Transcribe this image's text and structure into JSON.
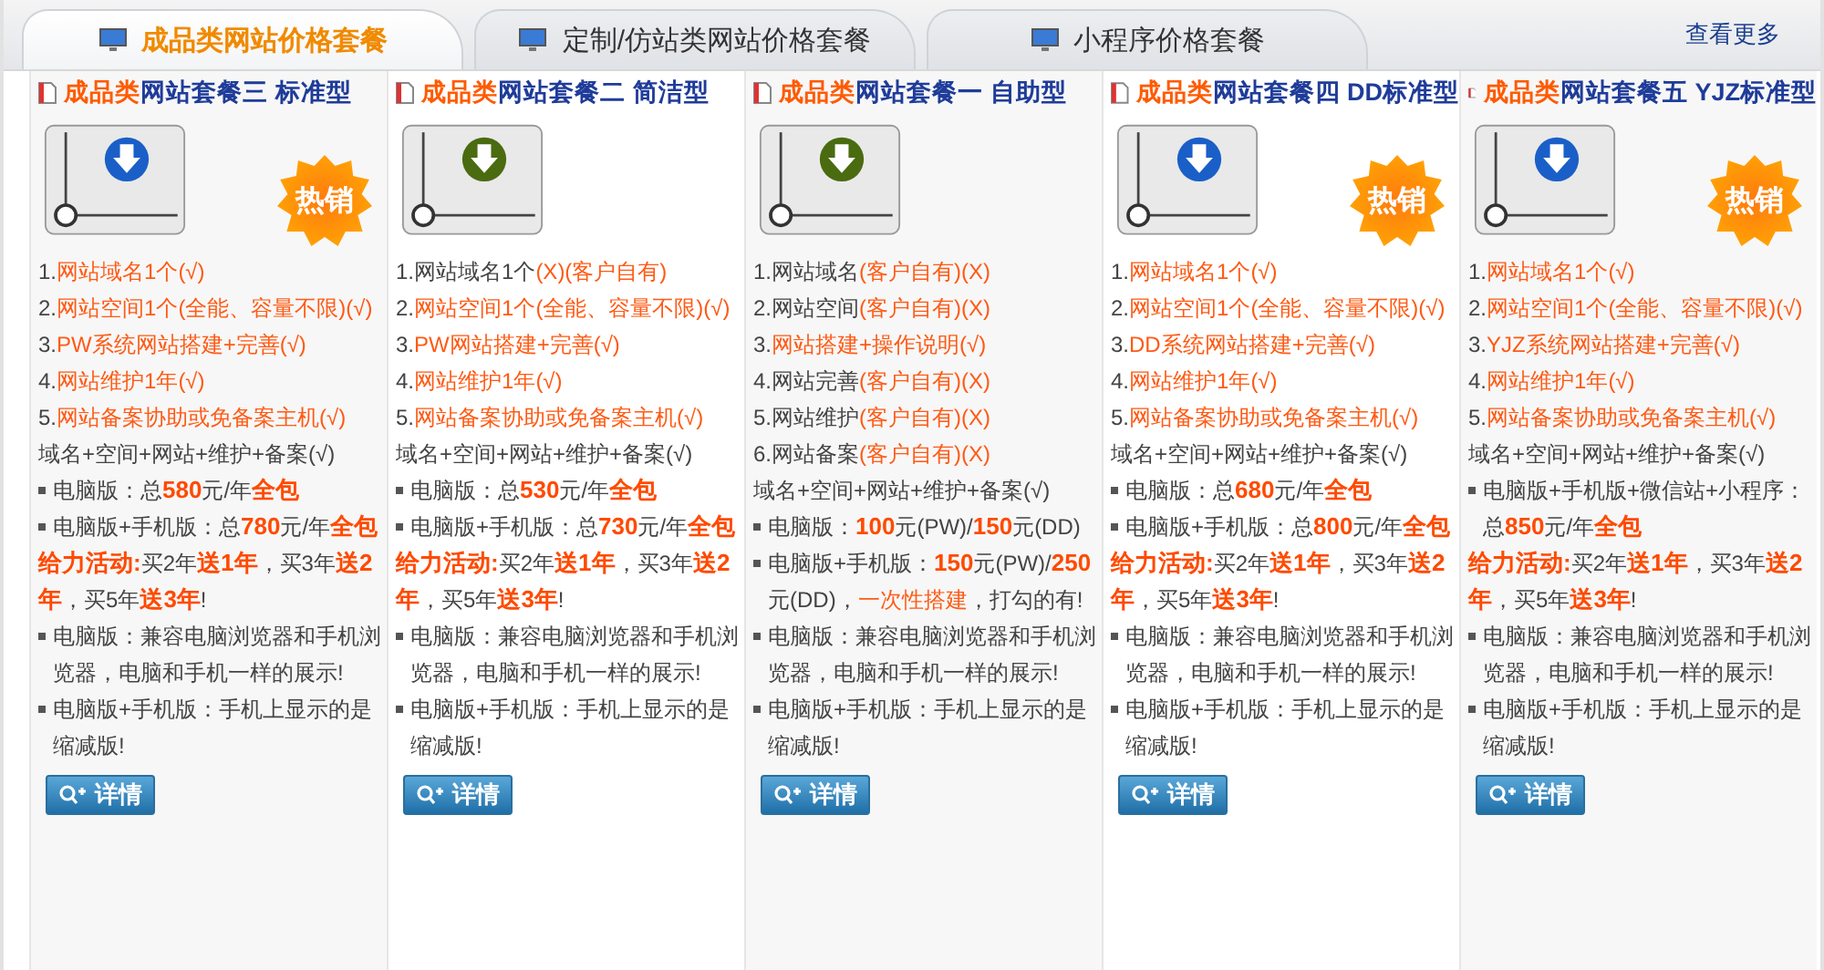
{
  "tabs": [
    {
      "label": "成品类网站价格套餐",
      "selected": true
    },
    {
      "label": "定制/仿站类网站价格套餐",
      "selected": false
    },
    {
      "label": "小程序价格套餐",
      "selected": false
    }
  ],
  "more_link": "查看更多",
  "cards": [
    {
      "title_prefix": "成品类",
      "title": "网站套餐三 标准型",
      "color": "#1a5fc8",
      "badge": "热销",
      "lines": [
        {
          "parts": [
            {
              "t": "1."
            },
            {
              "t": "网站域名1个(√)",
              "kind": "accent"
            }
          ]
        },
        {
          "parts": [
            {
              "t": "2."
            },
            {
              "t": "网站空间1个(全能、容量不限)(√)",
              "kind": "accent"
            }
          ]
        },
        {
          "parts": [
            {
              "t": "3."
            },
            {
              "t": "PW系统网站搭建+完善(√)",
              "kind": "accent"
            }
          ]
        },
        {
          "parts": [
            {
              "t": "4."
            },
            {
              "t": "网站维护1年(√)",
              "kind": "accent"
            }
          ]
        },
        {
          "parts": [
            {
              "t": "5."
            },
            {
              "t": "网站备案协助或免备案主机(√)",
              "kind": "accent"
            }
          ]
        },
        {
          "parts": [
            {
              "t": "域名+空间+网站+维护+备案(√)"
            }
          ]
        },
        {
          "bullet": true,
          "parts": [
            {
              "t": "电脑版：总"
            },
            {
              "t": "580",
              "kind": "strong"
            },
            {
              "t": "元/年"
            },
            {
              "t": "全包",
              "kind": "strong"
            }
          ]
        },
        {
          "bullet": true,
          "parts": [
            {
              "t": "电脑版+手机版：总"
            },
            {
              "t": "780",
              "kind": "strong"
            },
            {
              "t": "元/年"
            },
            {
              "t": "全包",
              "kind": "strong"
            }
          ]
        },
        {
          "parts": [
            {
              "t": "给力活动:",
              "kind": "strong"
            },
            {
              "t": "买2年"
            },
            {
              "t": "送1年",
              "kind": "strong"
            },
            {
              "t": "，买3年"
            },
            {
              "t": "送2年",
              "kind": "strong"
            },
            {
              "t": "，买5年"
            },
            {
              "t": "送3年",
              "kind": "strong"
            },
            {
              "t": "!"
            }
          ]
        },
        {
          "bullet": true,
          "parts": [
            {
              "t": "电脑版：兼容电脑浏览器和手机浏览器，电脑和手机一样的展示!"
            }
          ]
        },
        {
          "bullet": true,
          "parts": [
            {
              "t": "电脑版+手机版：手机上显示的是缩减版!"
            }
          ]
        }
      ],
      "button": "详情"
    },
    {
      "title_prefix": "成品类",
      "title": "网站套餐二 简洁型",
      "color": "#4a6b10",
      "lines": [
        {
          "parts": [
            {
              "t": "1.网站域名1个"
            },
            {
              "t": "(X)(客户自有)",
              "kind": "accent"
            }
          ]
        },
        {
          "parts": [
            {
              "t": "2."
            },
            {
              "t": "网站空间1个(全能、容量不限)(√)",
              "kind": "accent"
            }
          ]
        },
        {
          "parts": [
            {
              "t": "3."
            },
            {
              "t": "PW网站搭建+完善(√)",
              "kind": "accent"
            }
          ]
        },
        {
          "parts": [
            {
              "t": "4."
            },
            {
              "t": "网站维护1年(√)",
              "kind": "accent"
            }
          ]
        },
        {
          "parts": [
            {
              "t": "5."
            },
            {
              "t": "网站备案协助或免备案主机(√)",
              "kind": "accent"
            }
          ]
        },
        {
          "parts": [
            {
              "t": "域名+空间+网站+维护+备案(√)"
            }
          ]
        },
        {
          "bullet": true,
          "parts": [
            {
              "t": "电脑版：总"
            },
            {
              "t": "530",
              "kind": "strong"
            },
            {
              "t": "元/年"
            },
            {
              "t": "全包",
              "kind": "strong"
            }
          ]
        },
        {
          "bullet": true,
          "parts": [
            {
              "t": "电脑版+手机版：总"
            },
            {
              "t": "730",
              "kind": "strong"
            },
            {
              "t": "元/年"
            },
            {
              "t": "全包",
              "kind": "strong"
            }
          ]
        },
        {
          "parts": [
            {
              "t": "给力活动:",
              "kind": "strong"
            },
            {
              "t": "买2年"
            },
            {
              "t": "送1年",
              "kind": "strong"
            },
            {
              "t": "，买3年"
            },
            {
              "t": "送2年",
              "kind": "strong"
            },
            {
              "t": "，买5年"
            },
            {
              "t": "送3年",
              "kind": "strong"
            },
            {
              "t": "!"
            }
          ]
        },
        {
          "bullet": true,
          "parts": [
            {
              "t": "电脑版：兼容电脑浏览器和手机浏览器，电脑和手机一样的展示!"
            }
          ]
        },
        {
          "bullet": true,
          "parts": [
            {
              "t": "电脑版+手机版：手机上显示的是缩减版!"
            }
          ]
        }
      ],
      "button": "详情"
    },
    {
      "title_prefix": "成品类",
      "title": "网站套餐一 自助型",
      "color": "#4a6b10",
      "lines": [
        {
          "parts": [
            {
              "t": "1.网站域名"
            },
            {
              "t": "(客户自有)(X)",
              "kind": "accent"
            }
          ]
        },
        {
          "parts": [
            {
              "t": "2.网站空间"
            },
            {
              "t": "(客户自有)(X)",
              "kind": "accent"
            }
          ]
        },
        {
          "parts": [
            {
              "t": "3."
            },
            {
              "t": "网站搭建+操作说明(√)",
              "kind": "accent"
            }
          ]
        },
        {
          "parts": [
            {
              "t": "4.网站完善"
            },
            {
              "t": "(客户自有)(X)",
              "kind": "accent"
            }
          ]
        },
        {
          "parts": [
            {
              "t": "5.网站维护"
            },
            {
              "t": "(客户自有)(X)",
              "kind": "accent"
            }
          ]
        },
        {
          "parts": [
            {
              "t": "6.网站备案"
            },
            {
              "t": "(客户自有)(X)",
              "kind": "accent"
            }
          ]
        },
        {
          "parts": [
            {
              "t": "域名+空间+网站+维护+备案(√)"
            }
          ]
        },
        {
          "bullet": true,
          "parts": [
            {
              "t": "电脑版："
            },
            {
              "t": "100",
              "kind": "strong"
            },
            {
              "t": "元(PW)/"
            },
            {
              "t": "150",
              "kind": "strong"
            },
            {
              "t": "元(DD)"
            }
          ]
        },
        {
          "bullet": true,
          "parts": [
            {
              "t": "电脑版+手机版："
            },
            {
              "t": "150",
              "kind": "strong"
            },
            {
              "t": "元(PW)/"
            },
            {
              "t": "250",
              "kind": "strong"
            },
            {
              "t": "元(DD)，"
            },
            {
              "t": "一次性搭建",
              "kind": "accent"
            },
            {
              "t": "，打勾的有!"
            }
          ]
        },
        {
          "bullet": true,
          "parts": [
            {
              "t": "电脑版：兼容电脑浏览器和手机浏览器，电脑和手机一样的展示!"
            }
          ]
        },
        {
          "bullet": true,
          "parts": [
            {
              "t": "电脑版+手机版：手机上显示的是缩减版!"
            }
          ]
        }
      ],
      "button": "详情"
    },
    {
      "title_prefix": "成品类",
      "title": "网站套餐四 DD标准型",
      "color": "#1a5fc8",
      "badge": "热销",
      "lines": [
        {
          "parts": [
            {
              "t": "1."
            },
            {
              "t": "网站域名1个(√)",
              "kind": "accent"
            }
          ]
        },
        {
          "parts": [
            {
              "t": "2."
            },
            {
              "t": "网站空间1个(全能、容量不限)(√)",
              "kind": "accent"
            }
          ]
        },
        {
          "parts": [
            {
              "t": "3."
            },
            {
              "t": "DD系统网站搭建+完善(√)",
              "kind": "accent"
            }
          ]
        },
        {
          "parts": [
            {
              "t": "4."
            },
            {
              "t": "网站维护1年(√)",
              "kind": "accent"
            }
          ]
        },
        {
          "parts": [
            {
              "t": "5."
            },
            {
              "t": "网站备案协助或免备案主机(√)",
              "kind": "accent"
            }
          ]
        },
        {
          "parts": [
            {
              "t": "域名+空间+网站+维护+备案(√)"
            }
          ]
        },
        {
          "bullet": true,
          "parts": [
            {
              "t": "电脑版：总"
            },
            {
              "t": "680",
              "kind": "strong"
            },
            {
              "t": "元/年"
            },
            {
              "t": "全包",
              "kind": "strong"
            }
          ]
        },
        {
          "bullet": true,
          "parts": [
            {
              "t": "电脑版+手机版：总"
            },
            {
              "t": "800",
              "kind": "strong"
            },
            {
              "t": "元/年"
            },
            {
              "t": "全包",
              "kind": "strong"
            }
          ]
        },
        {
          "parts": [
            {
              "t": "给力活动:",
              "kind": "strong"
            },
            {
              "t": "买2年"
            },
            {
              "t": "送1年",
              "kind": "strong"
            },
            {
              "t": "，买3年"
            },
            {
              "t": "送2年",
              "kind": "strong"
            },
            {
              "t": "，买5年"
            },
            {
              "t": "送3年",
              "kind": "strong"
            },
            {
              "t": "!"
            }
          ]
        },
        {
          "bullet": true,
          "parts": [
            {
              "t": "电脑版：兼容电脑浏览器和手机浏览器，电脑和手机一样的展示!"
            }
          ]
        },
        {
          "bullet": true,
          "parts": [
            {
              "t": "电脑版+手机版：手机上显示的是缩减版!"
            }
          ]
        }
      ],
      "button": "详情"
    },
    {
      "title_prefix": "成品类",
      "title": "网站套餐五 YJZ标准型",
      "color": "#1a5fc8",
      "badge": "热销",
      "lines": [
        {
          "parts": [
            {
              "t": "1."
            },
            {
              "t": "网站域名1个(√)",
              "kind": "accent"
            }
          ]
        },
        {
          "parts": [
            {
              "t": "2."
            },
            {
              "t": "网站空间1个(全能、容量不限)(√)",
              "kind": "accent"
            }
          ]
        },
        {
          "parts": [
            {
              "t": "3."
            },
            {
              "t": "YJZ系统网站搭建+完善(√)",
              "kind": "accent"
            }
          ]
        },
        {
          "parts": [
            {
              "t": "4."
            },
            {
              "t": "网站维护1年(√)",
              "kind": "accent"
            }
          ]
        },
        {
          "parts": [
            {
              "t": "5."
            },
            {
              "t": "网站备案协助或免备案主机(√)",
              "kind": "accent"
            }
          ]
        },
        {
          "parts": [
            {
              "t": "域名+空间+网站+维护+备案(√)"
            }
          ]
        },
        {
          "bullet": true,
          "parts": [
            {
              "t": "电脑版+手机版+微信站+小程序：总"
            },
            {
              "t": "850",
              "kind": "strong"
            },
            {
              "t": "元/年"
            },
            {
              "t": "全包",
              "kind": "strong"
            }
          ]
        },
        {
          "parts": [
            {
              "t": "给力活动:",
              "kind": "strong"
            },
            {
              "t": "买2年"
            },
            {
              "t": "送1年",
              "kind": "strong"
            },
            {
              "t": "，买3年"
            },
            {
              "t": "送2年",
              "kind": "strong"
            },
            {
              "t": "，买5年"
            },
            {
              "t": "送3年",
              "kind": "strong"
            },
            {
              "t": "!"
            }
          ]
        },
        {
          "bullet": true,
          "parts": [
            {
              "t": "电脑版：兼容电脑浏览器和手机浏览器，电脑和手机一样的展示!"
            }
          ]
        },
        {
          "bullet": true,
          "parts": [
            {
              "t": "电脑版+手机版：手机上显示的是缩减版!"
            }
          ]
        }
      ],
      "button": "详情"
    }
  ]
}
